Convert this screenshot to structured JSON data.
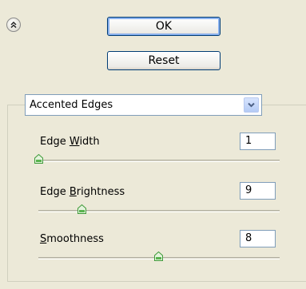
{
  "buttons": {
    "ok_label": "OK",
    "reset_label": "Reset"
  },
  "filter": {
    "selected": "Accented Edges"
  },
  "sliders": [
    {
      "pre": "Edge ",
      "mnemonic": "W",
      "post": "idth",
      "value": "1",
      "fraction": 0.0
    },
    {
      "pre": "Edge ",
      "mnemonic": "B",
      "post": "rightness",
      "value": "9",
      "fraction": 0.18
    },
    {
      "pre": "",
      "mnemonic": "S",
      "post": "moothness",
      "value": "8",
      "fraction": 0.5
    }
  ],
  "icons": {
    "collapse": "double-chevron-up-icon",
    "dropdown": "chevron-down-icon",
    "thumb": "slider-thumb-icon"
  },
  "colors": {
    "background": "#ece9d8",
    "button_border": "#003c74",
    "thumb": "#3f9a3a"
  }
}
